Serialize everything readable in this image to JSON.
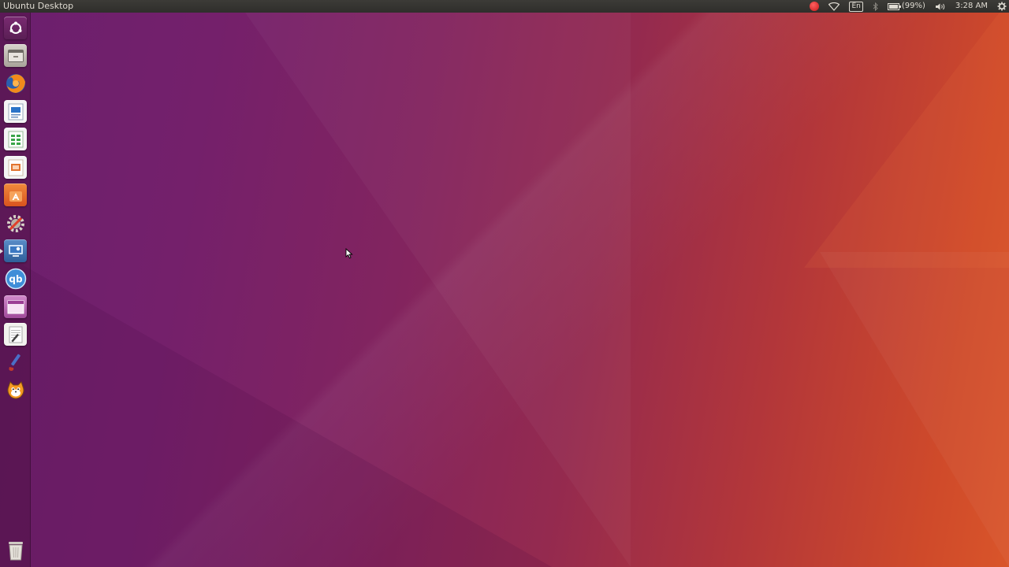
{
  "top_panel": {
    "title": "Ubuntu Desktop",
    "indicators": {
      "keyboard_layout": "En",
      "battery_text": "(99%)",
      "clock": "3:28 AM"
    }
  },
  "launcher": {
    "items": [
      {
        "name": "dash-home",
        "icon": "ubuntu-logo-icon"
      },
      {
        "name": "files",
        "icon": "file-manager-icon"
      },
      {
        "name": "firefox",
        "icon": "firefox-icon"
      },
      {
        "name": "libreoffice-writer",
        "icon": "writer-icon"
      },
      {
        "name": "libreoffice-calc",
        "icon": "calc-icon"
      },
      {
        "name": "libreoffice-impress",
        "icon": "impress-icon"
      },
      {
        "name": "ubuntu-software",
        "icon": "software-center-icon"
      },
      {
        "name": "system-settings",
        "icon": "settings-tools-icon"
      },
      {
        "name": "remote-desktop",
        "icon": "remote-desktop-icon"
      },
      {
        "name": "qbittorrent",
        "icon": "qbittorrent-icon"
      },
      {
        "name": "workspace-switcher",
        "icon": "workspaces-icon"
      },
      {
        "name": "text-editor",
        "icon": "text-editor-icon"
      },
      {
        "name": "paint-tool",
        "icon": "brush-icon"
      },
      {
        "name": "scratch",
        "icon": "scratch-cat-icon"
      }
    ],
    "trash": {
      "name": "trash",
      "icon": "trash-icon"
    }
  },
  "colors": {
    "panel_bg": "#3c3b37",
    "accent_orange": "#e95420",
    "wallpaper_purple": "#6b1f6e"
  }
}
